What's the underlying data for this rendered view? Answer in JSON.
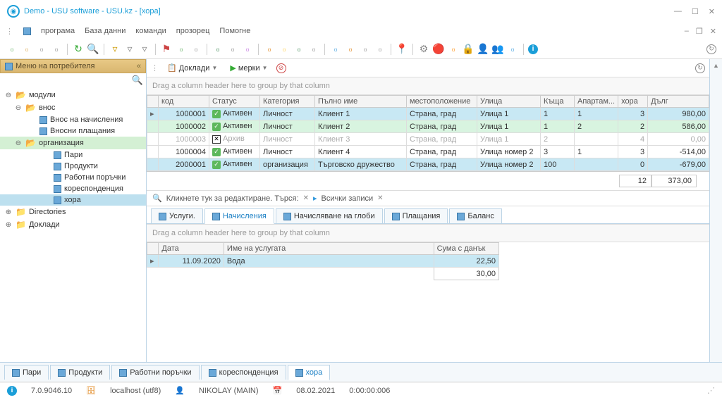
{
  "title": "Demo - USU software - USU.kz - [хора]",
  "menus": [
    "програма",
    "База данни",
    "команди",
    "прозорец",
    "Помогне"
  ],
  "sidebar": {
    "header": "Меню на потребителя",
    "items": {
      "modules": "модули",
      "import": "внос",
      "import_accruals": "Внос на начисления",
      "import_payments": "Вносни плащания",
      "organization": "организация",
      "money": "Пари",
      "products": "Продукти",
      "workorders": "Работни поръчки",
      "correspondence": "кореспонденция",
      "people": "хора",
      "directories": "Directories",
      "reports": "Доклади"
    }
  },
  "maintb": {
    "reports": "Доклади",
    "actions": "мерки"
  },
  "grouptext": "Drag a column header here to group by that column",
  "grid": {
    "cols": [
      "код",
      "Статус",
      "Категория",
      "Пълно име",
      "местоположение",
      "Улица",
      "Къща",
      "Апартам...",
      "хора",
      "Дълг"
    ],
    "rows": [
      {
        "code": "1000001",
        "status": "Активен",
        "ok": true,
        "cat": "Личност",
        "name": "Клиент 1",
        "loc": "Страна, град",
        "street": "Улица 1",
        "house": "1",
        "apt": "1",
        "ppl": "3",
        "debt": "980,00"
      },
      {
        "code": "1000002",
        "status": "Активен",
        "ok": true,
        "cat": "Личност",
        "name": "Клиент 2",
        "loc": "Страна, град",
        "street": "Улица 1",
        "house": "1",
        "apt": "2",
        "ppl": "2",
        "debt": "586,00"
      },
      {
        "code": "1000003",
        "status": "Архив",
        "ok": false,
        "cat": "Личност",
        "name": "Клиент 3",
        "loc": "Страна, град",
        "street": "Улица 1",
        "house": "2",
        "apt": "",
        "ppl": "4",
        "debt": "0,00"
      },
      {
        "code": "1000004",
        "status": "Активен",
        "ok": true,
        "cat": "Личност",
        "name": "Клиент 4",
        "loc": "Страна, град",
        "street": "Улица номер 2",
        "house": "3",
        "apt": "1",
        "ppl": "3",
        "debt": "-514,00"
      },
      {
        "code": "2000001",
        "status": "Активен",
        "ok": true,
        "cat": "организация",
        "name": "Търговско дружество",
        "loc": "Страна, град",
        "street": "Улица номер 2",
        "house": "100",
        "apt": "",
        "ppl": "0",
        "debt": "-679,00"
      }
    ],
    "sum_ppl": "12",
    "sum_debt": "373,00"
  },
  "search": {
    "text": "Кликнете тук за редактиране. Търся:",
    "all": "Всички записи"
  },
  "subtabs": [
    "Услуги.",
    "Начисления",
    "Начисляване на глоби",
    "Плащания",
    "Баланс"
  ],
  "detail": {
    "cols": [
      "Дата",
      "Име на услугата",
      "Сума с данък"
    ],
    "row": {
      "date": "11.09.2020",
      "name": "Вода",
      "sum": "22,50"
    },
    "total": "30,00"
  },
  "doctabs": [
    "Пари",
    "Продукти",
    "Работни поръчки",
    "кореспонденция",
    "хора"
  ],
  "status": {
    "ver": "7.0.9046.10",
    "host": "localhost (utf8)",
    "user": "NIKOLAY (MAIN)",
    "date": "08.02.2021",
    "time": "0:00:00:006"
  }
}
